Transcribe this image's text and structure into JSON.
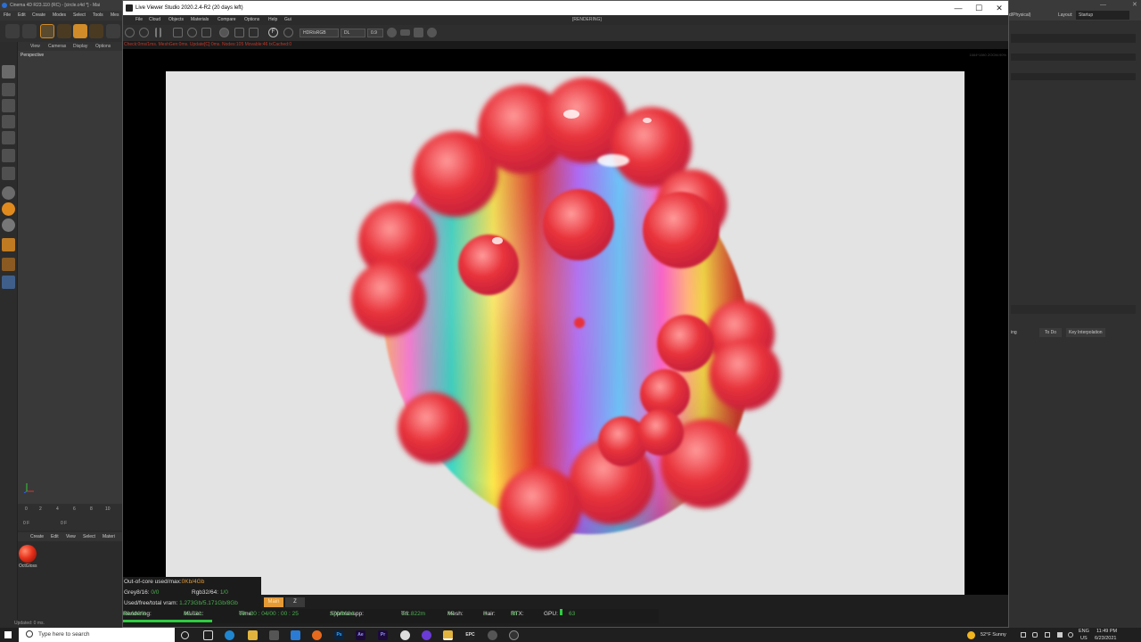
{
  "c4d": {
    "title": "Cinema 4D R23.110 (RC) - [circle.c4d *] - Mai",
    "menu": [
      "File",
      "Edit",
      "Create",
      "Modes",
      "Select",
      "Tools",
      "Mes"
    ],
    "viewport_menu": [
      "View",
      "Cameras",
      "Display",
      "Options"
    ],
    "viewport_label": "Perspective",
    "timeline_ticks": [
      "0",
      "2",
      "4",
      "6",
      "8",
      "10"
    ],
    "frame_start": "0 F",
    "frame_end": "0 F",
    "material_menu": [
      "Create",
      "Edit",
      "View",
      "Select",
      "Materi"
    ],
    "material_name": "OctGloss",
    "status": "Updated: 0 ms.",
    "layout_label": "Layout:",
    "layout_value": "Startup",
    "layout_prefix": "d/Physical)",
    "attr_columns": [
      "ing",
      "To Do",
      "Key Interpolation"
    ]
  },
  "live_viewer": {
    "title": "Live Viewer Studio 2020.2.4-R2 (20 days left)",
    "menu": [
      "File",
      "Cloud",
      "Objects",
      "Materials",
      "Compare",
      "Options",
      "Help",
      "Gui"
    ],
    "state": "[RENDERING]",
    "color_space": "HDR/sRGB",
    "channel": "DL",
    "exposure": "0.9",
    "info_line": "Check:0ms/1ms. MeshGen:0ms. Update[C]:0ms. Nodes:105 Movable:46 txCached:0",
    "resolution_overlay": "1664*1080 ZOOM:90%"
  },
  "stats": {
    "ooc_label": "Out-of-core used/max:",
    "ooc_value": "0Kb/4Gb",
    "grey_label": "Grey8/16:",
    "grey_value": "0/0",
    "rgb_label": "Rgb32/64:",
    "rgb_value": "1/0",
    "vram_label": "Used/free/total vram:",
    "vram_value": "1.273Gb/5.171Gb/8Gb",
    "btn_main": "Main",
    "btn_z": "Z"
  },
  "status_bar": {
    "rendering_label": "Rendering:",
    "rendering_value": "16.602%",
    "ms_label": "Ms/sec:",
    "ms_value": "97.731",
    "time_label": "Time:",
    "time_value": "00 : 00 : 04/00 : 00 : 25",
    "spp_label": "Spp/maxspp:",
    "spp_value": "170/1024",
    "tri_label": "Tri:",
    "tri_value": "0/1.822m",
    "mesh_label": "Mesh:",
    "mesh_value": "47",
    "hair_label": "Hair:",
    "hair_value": "0",
    "rtx_label": "RTX:",
    "rtx_value": "off",
    "gpu_label": "GPU:",
    "gpu_value": "63",
    "progress": 0.166
  },
  "taskbar": {
    "search_placeholder": "Type here to search",
    "apps": [
      "Ps",
      "Ae",
      "Pr",
      "Cr",
      "EPC"
    ],
    "weather": "52°F  Sunny",
    "lang_top": "ENG",
    "lang_bottom": "US",
    "time": "11:49 PM",
    "date": "6/23/2021"
  },
  "colors": {
    "accent_green": "#2ecc40",
    "accent_orange": "#e59a35",
    "info_red": "#c0392b",
    "ball_red": "#e8321c"
  }
}
